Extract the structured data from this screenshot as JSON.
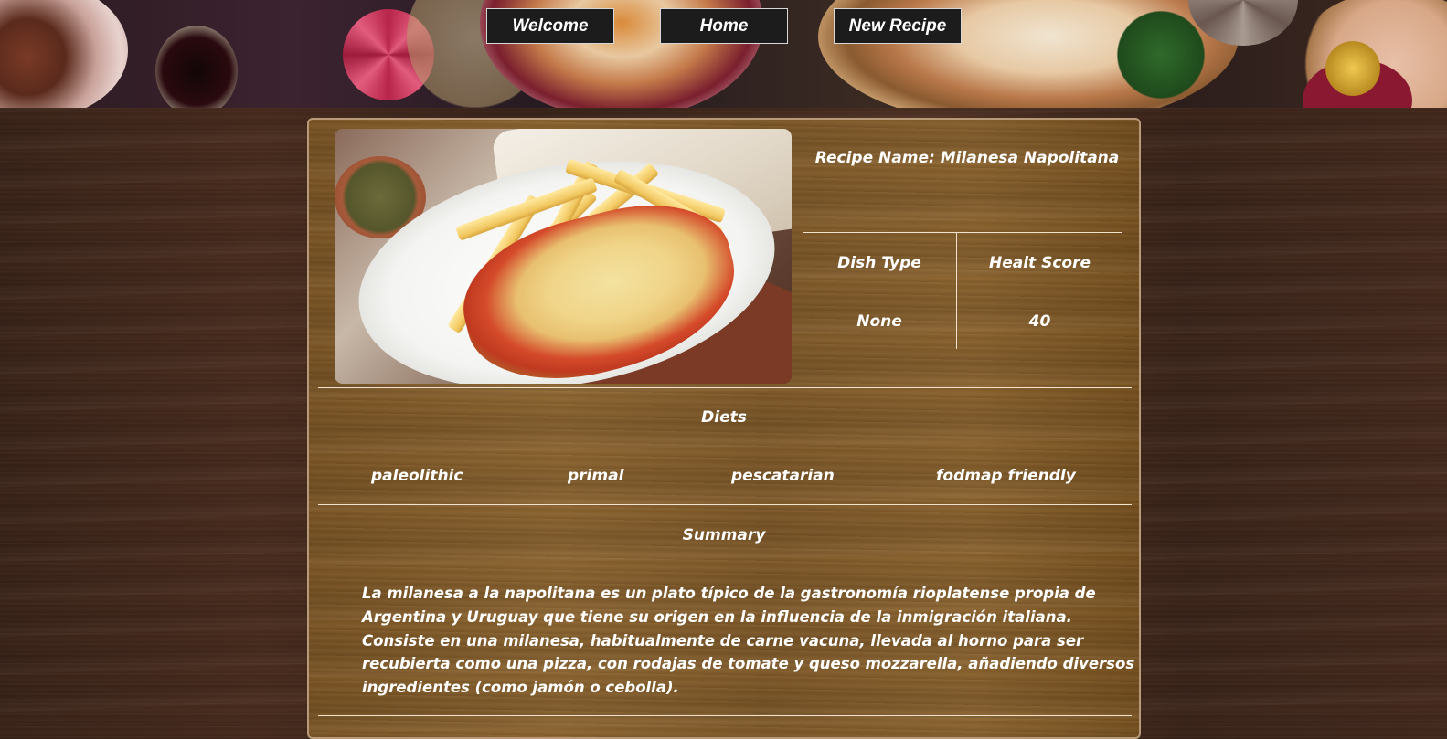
{
  "nav": {
    "welcome": "Welcome",
    "home": "Home",
    "new_recipe": "New Recipe"
  },
  "recipe": {
    "name_label": "Recipe Name: Milanesa Napolitana",
    "photo_icon": "food-photo",
    "dish_type_header": "Dish Type",
    "health_score_header": "Healt Score",
    "dish_type_value": "None",
    "health_score_value": "40",
    "diets_header": "Diets",
    "diets": [
      "paleolithic",
      "primal",
      "pescatarian",
      "fodmap friendly"
    ],
    "summary_header": "Summary",
    "summary_lines": [
      "La milanesa a la napolitana es un plato típico de la gastronomía rioplatense propia de",
      "Argentina y Uruguay que tiene su origen en la influencia de la inmigración italiana.",
      "Consiste en una milanesa, habitualmente de carne vacuna, llevada al horno para ser",
      "recubierta como una pizza, con rodajas de tomate y queso mozzarella, añadiendo diversos",
      "ingredientes (como jamón o cebolla)."
    ]
  },
  "colors": {
    "nav_button_bg": "#1c1c1c",
    "card_border": "#b89a7a",
    "text": "#ffffff"
  }
}
